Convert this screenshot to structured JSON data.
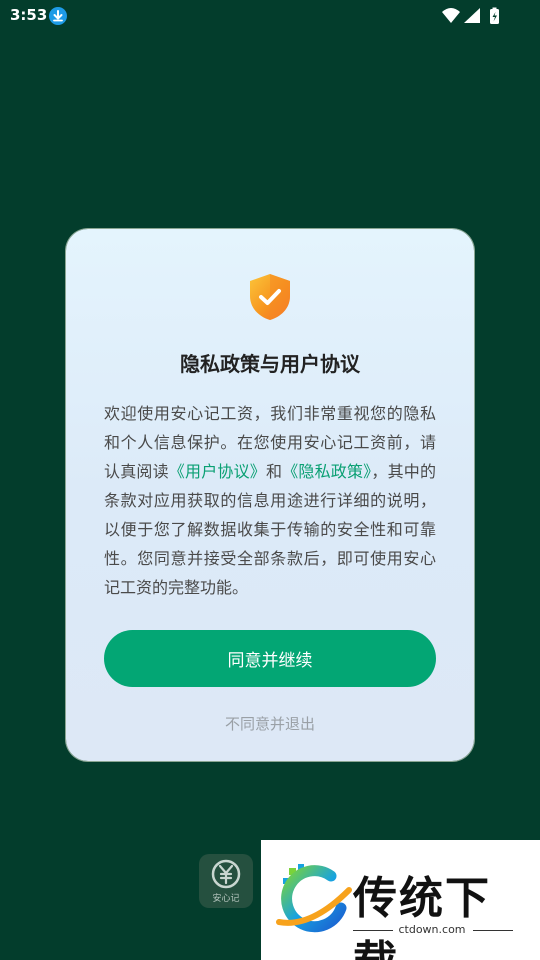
{
  "status_bar": {
    "time": "3:53",
    "icons": [
      "download-icon",
      "wifi-icon",
      "signal-icon",
      "battery-charging-icon"
    ]
  },
  "dialog": {
    "icon": "shield-check-icon",
    "title": "隐私政策与用户协议",
    "body": {
      "part1": "欢迎使用安心记工资，我们非常重视您的隐私和个人信息保护。在您使用安心记工资前，请认真阅读",
      "link_user_agreement": "《用户协议》",
      "and": "和",
      "link_privacy_policy": "《隐私政策》",
      "part2": "，其中的条款对应用获取的信息用途进行详细的说明，以便于您了解数据收集于传输的安全性和可靠性。您同意并接受全部条款后，即可使用安心记工资的完整功能。"
    },
    "agree_label": "同意并继续",
    "decline_label": "不同意并退出"
  },
  "app_icon": {
    "label": "安心记",
    "icon": "yuan-icon"
  },
  "watermark": {
    "title": "传统下载",
    "url": "ctdown.com",
    "logo": "ctdown-logo-icon"
  },
  "colors": {
    "background": "#033d2c",
    "accent": "#03a674",
    "link": "#0aa073",
    "shield_orange": "#f7951f",
    "shield_yellow": "#fbc53a"
  }
}
